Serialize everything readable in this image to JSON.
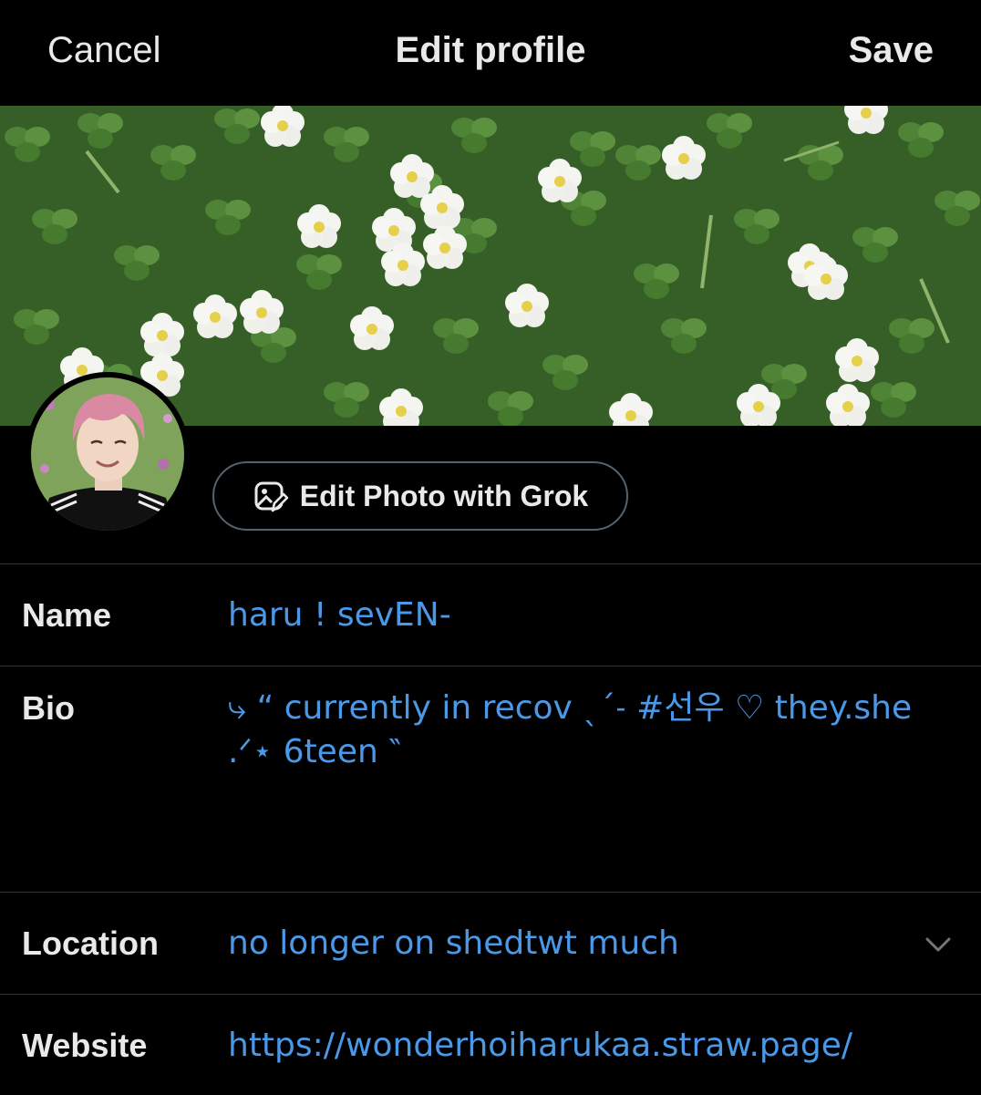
{
  "header": {
    "cancel_label": "Cancel",
    "title": "Edit profile",
    "save_label": "Save"
  },
  "banner": {
    "icon": "banner-image",
    "colors": {
      "leaf_dark": "#2f5a22",
      "leaf_light": "#6b9a48",
      "flower": "#f4f4f0",
      "flower_center": "#e6cf4a"
    }
  },
  "avatar": {
    "icon": "profile-photo",
    "colors": {
      "hair": "#d98aa2",
      "skin": "#f1d6c4",
      "shirt": "#111111",
      "background": "#7fa35a"
    }
  },
  "grok_button": {
    "label": "Edit Photo with Grok",
    "icon": "image-edit-icon"
  },
  "form": {
    "name": {
      "label": "Name",
      "value": "haru ! sevEN-"
    },
    "bio": {
      "label": "Bio",
      "value": "⤷ “ currently in recov ˎˊ˗ #선우 ♡ they.she .ᐟ⋆ 6teen ‶"
    },
    "location": {
      "label": "Location",
      "value": "no longer on shedtwt much",
      "icon": "chevron-down-icon"
    },
    "website": {
      "label": "Website",
      "value": "https://wonderhoiharukaa.straw.page/"
    }
  },
  "colors": {
    "background": "#000000",
    "text": "#e7e9ea",
    "link": "#4a99e9",
    "divider": "#2f3336",
    "button_border": "#536471"
  }
}
